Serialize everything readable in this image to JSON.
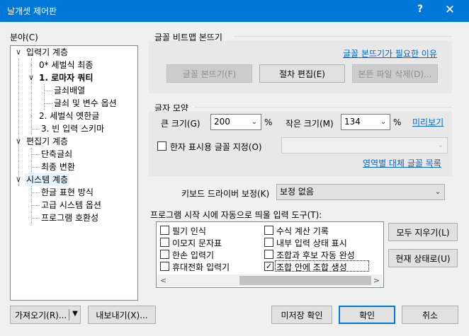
{
  "window": {
    "title": "날개셋 제어판",
    "help_label": "?",
    "close_label": "✕"
  },
  "left": {
    "section_label": "분야(C)",
    "tree": [
      {
        "label": "입력기 계층",
        "expander": "∨"
      },
      {
        "label": "0* 세벌식 최종",
        "expander": "›"
      },
      {
        "label": "1. 로마자 쿼티",
        "expander": "∨"
      },
      {
        "label": "글쇠배열",
        "expander": ""
      },
      {
        "label": "글쇠 및 변수 옵션",
        "expander": ""
      },
      {
        "label": "2. 세벌식 옛한글",
        "expander": "›"
      },
      {
        "label": "3. 빈 입력 스키마",
        "expander": ""
      },
      {
        "label": "편집기 계층",
        "expander": "∨"
      },
      {
        "label": "단축글쇠",
        "expander": ""
      },
      {
        "label": "최종 변환",
        "expander": ""
      },
      {
        "label": "시스템 계층",
        "expander": "∨"
      },
      {
        "label": "한글 표현 방식",
        "expander": ""
      },
      {
        "label": "고급 시스템 옵션",
        "expander": ""
      },
      {
        "label": "프로그램 호환성",
        "expander": ""
      }
    ]
  },
  "bitmap": {
    "title": "글꼴 비트맵 본뜨기",
    "link": "글꼴 본뜨기가 필요한 이유",
    "copy_button": "글꼴 본뜨기(F)",
    "edit_button": "절차 편집(E)",
    "delete_button": "본뜬 파일 삭제(D)..."
  },
  "shape": {
    "title": "글자 모양",
    "big_size_label": "큰 크기(G)",
    "big_size_value": "200",
    "percent": "%",
    "small_size_label": "작은 크기(M)",
    "small_size_value": "134",
    "preview_link": "미리보기",
    "hanja_checkbox_label": "한자 표시용 글꼴 지정(O)",
    "hanja_font_value": "",
    "region_link": "영역별 대체 글꼴 목록"
  },
  "keyboard": {
    "label": "키보드 드라이버 보정(K)",
    "value": "보정 없음"
  },
  "startup": {
    "label": "프로그램 시작 시에 자동으로 띄울 입력 도구(T):",
    "items": [
      {
        "label": "필기 인식",
        "checked": ""
      },
      {
        "label": "이모지 문자표",
        "checked": ""
      },
      {
        "label": "한손 입력기",
        "checked": ""
      },
      {
        "label": "휴대전화 입력기",
        "checked": ""
      },
      {
        "label": "수식 계산 기록",
        "checked": ""
      },
      {
        "label": "내부 입력 상태 표시",
        "checked": ""
      },
      {
        "label": "조합과 후보 자동 완성",
        "checked": ""
      },
      {
        "label": "조합 안에 조합 생성",
        "checked": "✓"
      }
    ],
    "scroll_left": "<",
    "scroll_right": ">",
    "clear_all_button": "모두 지우기(L)",
    "current_state_button": "현재 상태로(U)"
  },
  "footer": {
    "import_button": "가져오기(R)...",
    "import_dropdown": "▼",
    "export_button": "내보내기(X)...",
    "unsaved_button": "미저장 확인",
    "ok_button": "확인",
    "cancel_button": "취소"
  },
  "colors": {
    "accent": "#0078d7",
    "link": "#0066cc"
  }
}
